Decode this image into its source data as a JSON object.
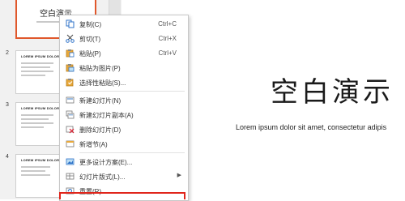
{
  "thumbnails": [
    {
      "number": "",
      "title": "空白演示"
    },
    {
      "number": "2",
      "heading": "LOREM IPSUM DOLOR"
    },
    {
      "number": "3",
      "heading": "LOREM IPSUM DOLOR"
    },
    {
      "number": "4",
      "heading": "LOREM IPSUM DOLOR"
    }
  ],
  "slide": {
    "title": "空白演示",
    "subtitle": "Lorem ipsum dolor sit amet, consectetur adipis"
  },
  "context_menu": {
    "items": [
      {
        "label": "复制(C)",
        "shortcut": "Ctrl+C",
        "icon": "copy-icon"
      },
      {
        "label": "剪切(T)",
        "shortcut": "Ctrl+X",
        "icon": "cut-icon"
      },
      {
        "label": "粘贴(P)",
        "shortcut": "Ctrl+V",
        "icon": "paste-icon"
      },
      {
        "label": "粘贴为图片(P)",
        "shortcut": "",
        "icon": "paste-picture-icon"
      },
      {
        "label": "选择性粘贴(S)...",
        "shortcut": "",
        "icon": "paste-special-icon"
      },
      {
        "label": "新建幻灯片(N)",
        "shortcut": "",
        "icon": "new-slide-icon"
      },
      {
        "label": "新建幻灯片副本(A)",
        "shortcut": "",
        "icon": "duplicate-slide-icon"
      },
      {
        "label": "删除幻灯片(D)",
        "shortcut": "",
        "icon": "delete-slide-icon"
      },
      {
        "label": "新增节(A)",
        "shortcut": "",
        "icon": "new-section-icon"
      },
      {
        "label": "更多设计方案(E)...",
        "shortcut": "",
        "icon": "design-icon"
      },
      {
        "label": "幻灯片版式(L)...",
        "shortcut": "",
        "icon": "layout-icon"
      },
      {
        "label": "重置(R)",
        "shortcut": "",
        "icon": "reset-icon"
      }
    ]
  },
  "colors": {
    "accent": "#e0582c",
    "highlight": "#e0251b",
    "menu_icon_blue": "#2f73c9",
    "menu_icon_yellow": "#e8a83a"
  }
}
